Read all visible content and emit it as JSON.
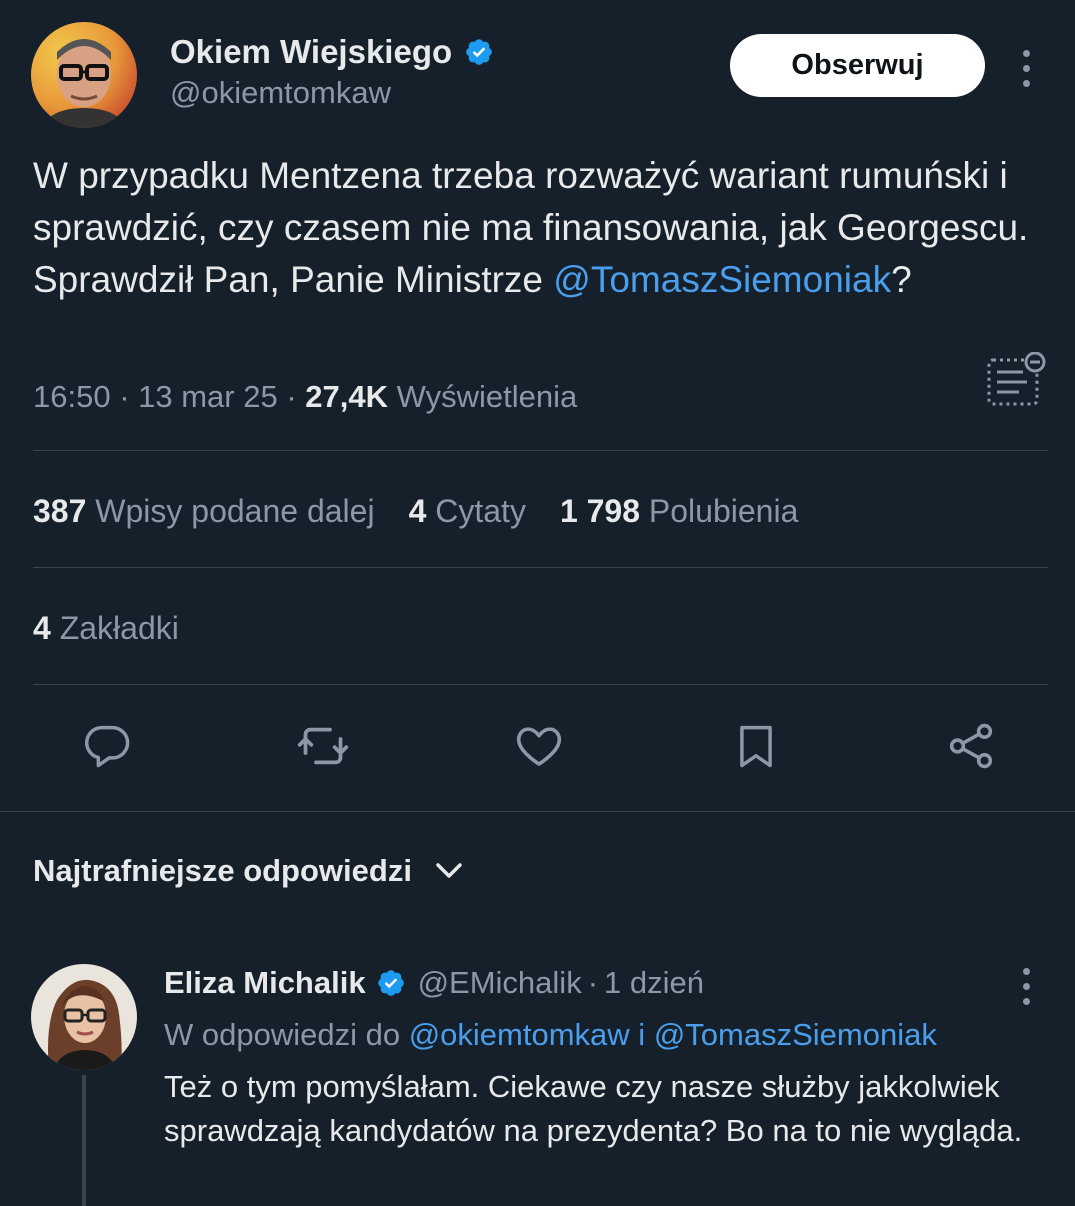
{
  "tweet": {
    "author": {
      "name": "Okiem Wiejskiego",
      "handle": "@okiemtomkaw",
      "verified": true
    },
    "follow_label": "Obserwuj",
    "text": {
      "body": "W przypadku Mentzena trzeba rozważyć wariant rumuński i sprawdzić, czy czasem nie ma finansowania, jak Georgescu. Sprawdził Pan, Panie Ministrze ",
      "mention": "@TomaszSiemoniak",
      "tail": "?"
    },
    "time": "16:50",
    "date": "13 mar 25",
    "views_count": "27,4K",
    "views_label": "Wyświetlenia",
    "stats": {
      "reposts_count": "387",
      "reposts_label": "Wpisy podane dalej",
      "quotes_count": "4",
      "quotes_label": "Cytaty",
      "likes_count": "1 798",
      "likes_label": "Polubienia"
    },
    "bookmarks": {
      "count": "4",
      "label": "Zakładki"
    }
  },
  "actions": [
    "reply-icon",
    "retweet-icon",
    "like-icon",
    "bookmark-icon",
    "share-icon"
  ],
  "replies_header": "Najtrafniejsze odpowiedzi",
  "reply": {
    "author": {
      "name": "Eliza Michalik",
      "handle": "@EMichalik",
      "verified": true
    },
    "time_sep": "·",
    "time": "1 dzień",
    "reply_to_prefix": "W odpowiedzi do",
    "reply_to_user1": "@okiemtomkaw",
    "reply_to_and": "i",
    "reply_to_user2": "@TomaszSiemoniak",
    "text": "Też o tym pomyślałam. Ciekawe czy nasze służby jakkolwiek sprawdzają kandydatów na prezydenta? Bo na to nie wygląda."
  },
  "colors": {
    "background": "#15202b",
    "text": "#e7e9ea",
    "muted": "#8b98a5",
    "link": "#4a9eeb",
    "verified": "#1d9bf0",
    "divider": "#38444d"
  }
}
